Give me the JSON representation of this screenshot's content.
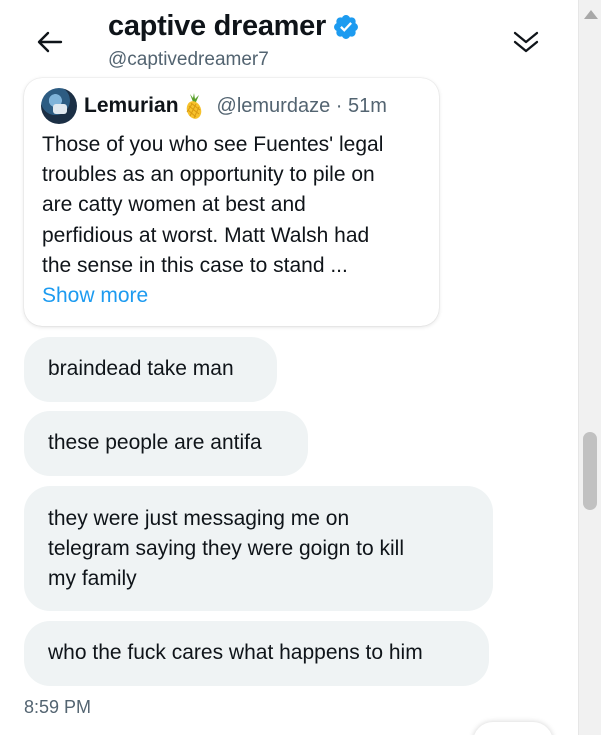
{
  "header": {
    "title": "captive dreamer",
    "handle": "@captivedreamer7",
    "back_icon": "arrow-left-icon",
    "verified_icon": "verified-badge-icon",
    "collapse_icon": "double-chevron-down-icon"
  },
  "quoted_tweet": {
    "author_name": "Lemurian",
    "author_emoji": "pineapple-emoji",
    "handle_time": "@lemurdaze · 51m",
    "lines": [
      "Those of you who see Fuentes' legal",
      "troubles as an opportunity to pile on",
      "are catty women at best and",
      "perfidious at worst. Matt Walsh had",
      "the sense in this case to stand ..."
    ],
    "show_more": "Show more"
  },
  "messages": [
    {
      "lines": [
        "braindead take man"
      ]
    },
    {
      "lines": [
        "these people are antifa"
      ]
    },
    {
      "lines": [
        "they were just messaging me on",
        "telegram saying they were goign to kill",
        "my family"
      ]
    },
    {
      "lines": [
        "who the fuck cares what happens to him"
      ]
    }
  ],
  "timestamp": "8:59 PM",
  "colors": {
    "accent": "#1d9bf0",
    "bubble_bg": "#eff3f4",
    "text": "#0f1419",
    "secondary_text": "#536471"
  }
}
